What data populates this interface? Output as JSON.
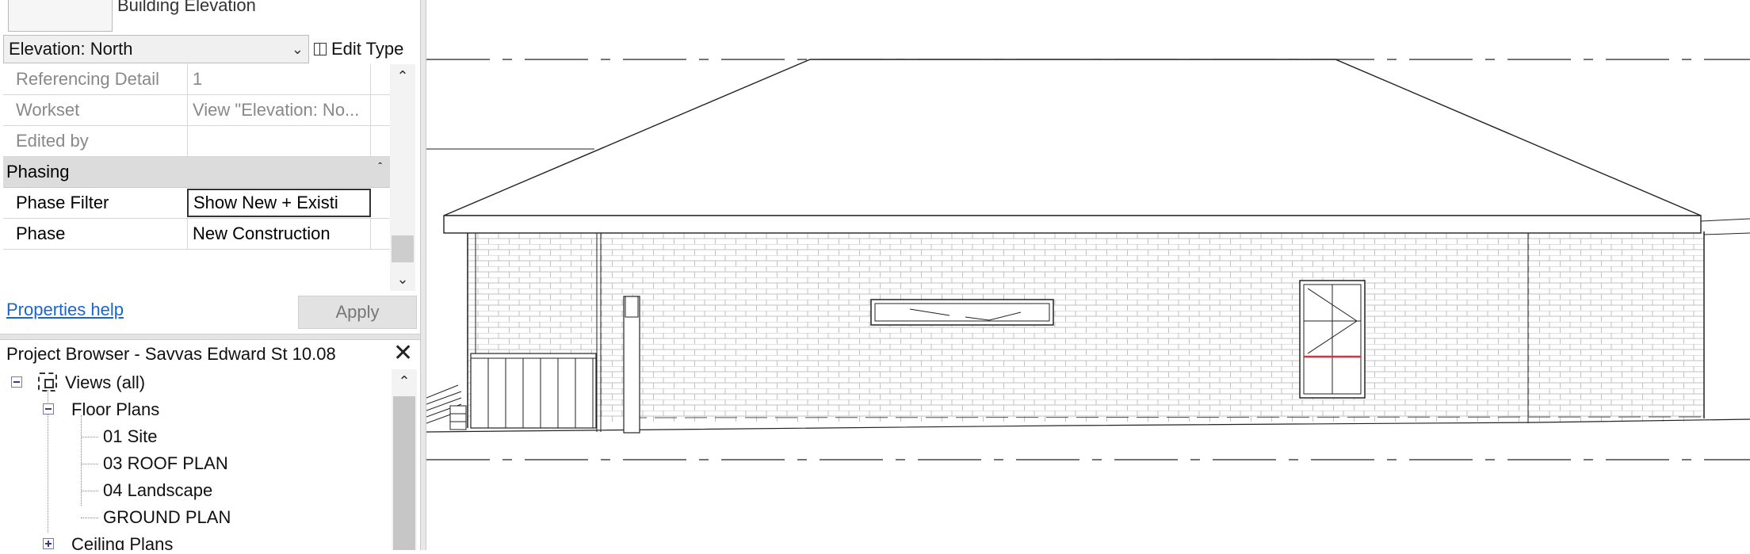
{
  "properties": {
    "type_name": "Building Elevation",
    "selector_value": "Elevation: North",
    "edit_type_label": "Edit Type",
    "rows_top": [
      {
        "label": "Referencing Detail",
        "value": "1"
      },
      {
        "label": "Workset",
        "value": "View \"Elevation: No..."
      },
      {
        "label": "Edited by",
        "value": ""
      }
    ],
    "group_label": "Phasing",
    "rows_phasing": [
      {
        "label": "Phase Filter",
        "value": "Show New + Existi"
      },
      {
        "label": "Phase",
        "value": "New Construction"
      }
    ],
    "help_link": "Properties help",
    "apply_label": "Apply"
  },
  "browser": {
    "title": "Project Browser - Savvas Edward St 10.08",
    "views_label": "Views (all)",
    "floor_plans_label": "Floor Plans",
    "floor_plan_items": [
      "01 Site",
      "03 ROOF PLAN",
      "04 Landscape",
      "GROUND PLAN"
    ],
    "ceiling_plans_label": "Ceiling Plans"
  },
  "colors": {
    "link": "#1a66cc",
    "group_bg": "#dcdcdc",
    "window_highlight": "#e03040"
  },
  "icons": [
    "chevron-down-icon",
    "edit-type-icon",
    "collapse-icon",
    "scroll-up-icon",
    "scroll-down-icon",
    "close-icon",
    "expand-icon",
    "views-icon"
  ]
}
